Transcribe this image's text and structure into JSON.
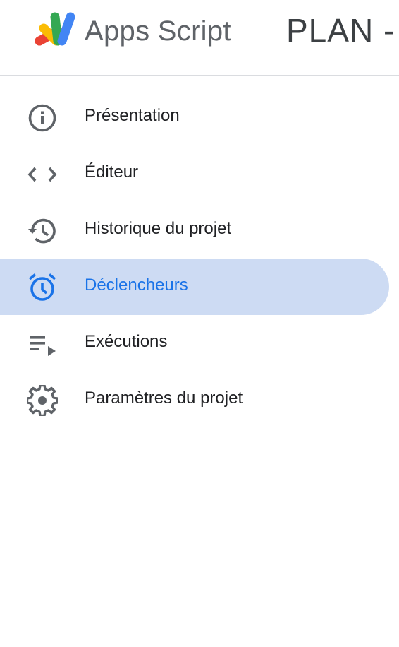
{
  "header": {
    "app_name": "Apps Script",
    "project_title": "PLAN -"
  },
  "colors": {
    "active_bg": "#cddbf3",
    "active_text": "#1a73e8",
    "icon": "#5f6368",
    "text": "#202124"
  },
  "sidebar": {
    "items": [
      {
        "label": "Présentation",
        "icon": "info-icon",
        "active": false
      },
      {
        "label": "Éditeur",
        "icon": "code-icon",
        "active": false
      },
      {
        "label": "Historique du projet",
        "icon": "history-icon",
        "active": false
      },
      {
        "label": "Déclencheurs",
        "icon": "alarm-icon",
        "active": true
      },
      {
        "label": "Exécutions",
        "icon": "playlist-play-icon",
        "active": false
      },
      {
        "label": "Paramètres du projet",
        "icon": "gear-icon",
        "active": false
      }
    ]
  }
}
